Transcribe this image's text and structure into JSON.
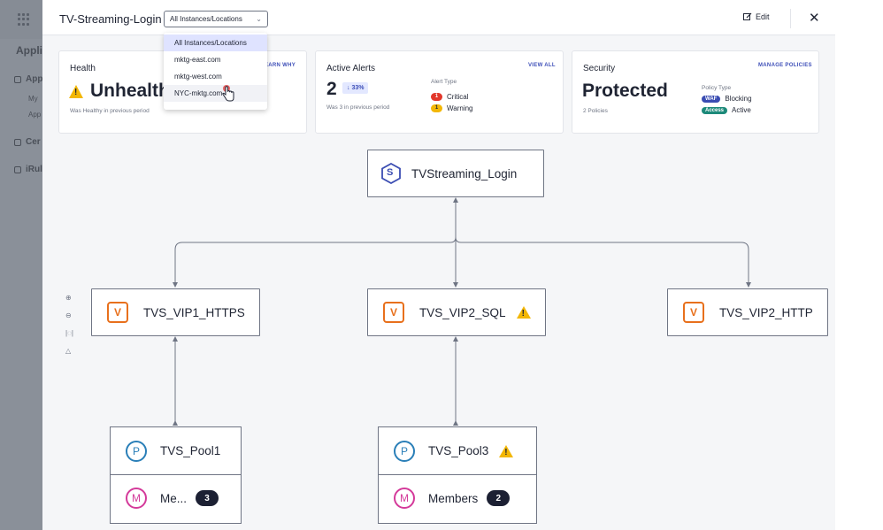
{
  "background": {
    "title": "Appli",
    "nav": [
      {
        "label": "App",
        "icon": "apps-icon"
      },
      {
        "label": "My",
        "icon": ""
      },
      {
        "label": "App",
        "icon": ""
      },
      {
        "label": "Cer",
        "icon": "certificate-icon"
      },
      {
        "label": "iRul",
        "icon": "irule-icon"
      }
    ]
  },
  "header": {
    "title": "TV-Streaming-Login",
    "select_value": "All Instances/Locations",
    "edit_label": "Edit"
  },
  "dropdown": {
    "options": [
      "All Instances/Locations",
      "mktg-east.com",
      "mktg-west.com",
      "NYC-mktg.com"
    ],
    "selected": "All Instances/Locations",
    "hovered": "NYC-mktg.com"
  },
  "cards": {
    "health": {
      "title": "Health",
      "link": "LEARN WHY",
      "status": "Unhealthy",
      "note": "Was Healthy in previous period"
    },
    "alerts": {
      "title": "Active Alerts",
      "link": "VIEW ALL",
      "count": "2",
      "delta": "↓ 33%",
      "note": "Was 3 in previous period",
      "type_label": "Alert Type",
      "types": [
        {
          "count": "1",
          "label": "Critical",
          "color": "#e2372b"
        },
        {
          "count": "1",
          "label": "Warning",
          "color": "#f3b705"
        }
      ]
    },
    "security": {
      "title": "Security",
      "link": "MANAGE POLICIES",
      "status": "Protected",
      "note": "2 Policies",
      "type_label": "Policy Type",
      "policies": [
        {
          "tag": "WAF",
          "label": "Blocking"
        },
        {
          "tag": "Access",
          "label": "Active"
        }
      ]
    }
  },
  "diagram": {
    "root": {
      "badge": "S",
      "label": "TVStreaming_Login"
    },
    "vips": [
      {
        "badge": "V",
        "label": "TVS_VIP1_HTTPS",
        "warning": false
      },
      {
        "badge": "V",
        "label": "TVS_VIP2_SQL",
        "warning": true
      },
      {
        "badge": "V",
        "label": "TVS_VIP2_HTTP",
        "warning": false
      }
    ],
    "pools": [
      {
        "badge": "P",
        "label": "TVS_Pool1",
        "warning": false,
        "members_badge": "M",
        "members_label": "Me...",
        "members_count": "3"
      },
      {
        "badge": "P",
        "label": "TVS_Pool3",
        "warning": true,
        "members_badge": "M",
        "members_label": "Members",
        "members_count": "2"
      }
    ]
  },
  "colors": {
    "accent": "#3e4fb8",
    "vip": "#e8701c",
    "pool": "#2a7fb8",
    "members": "#d43a9a",
    "warning": "#f3b705",
    "critical": "#e2372b"
  }
}
